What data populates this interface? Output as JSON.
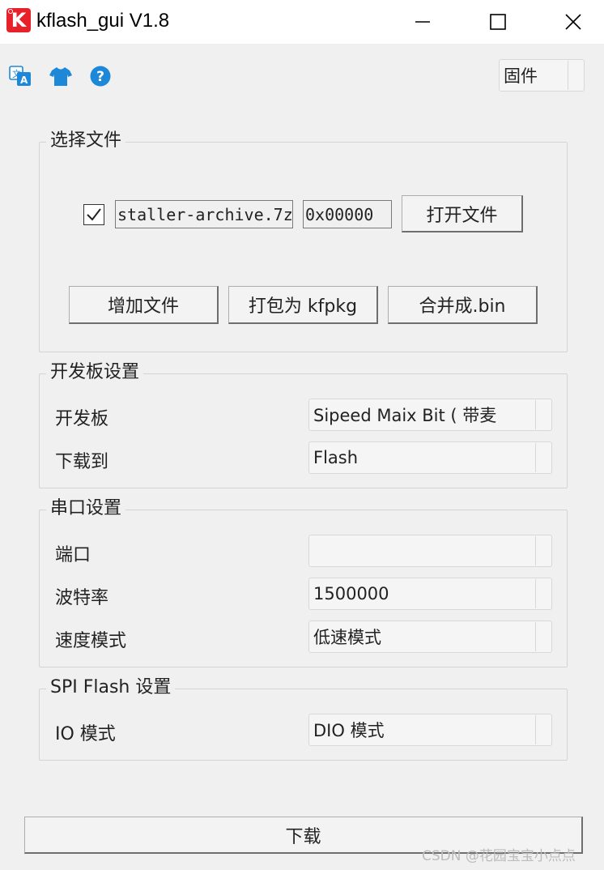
{
  "window": {
    "title": "kflash_gui V1.8",
    "logo_letter": "K"
  },
  "toolbar": {
    "icons": [
      "translate-icon",
      "shirt-icon",
      "help-icon"
    ],
    "mode_select": "固件"
  },
  "file_group": {
    "title": "选择文件",
    "file_checked": true,
    "file_name": "staller-archive.7z",
    "address": "0x00000",
    "open_label": "打开文件",
    "add_label": "增加文件",
    "pack_label": "打包为 kfpkg",
    "merge_label": "合并成.bin"
  },
  "board_group": {
    "title": "开发板设置",
    "board_label": "开发板",
    "board_value": "Sipeed Maix Bit ( 带麦",
    "target_label": "下载到",
    "target_value": "Flash"
  },
  "serial_group": {
    "title": "串口设置",
    "port_label": "端口",
    "port_value": "",
    "baud_label": "波特率",
    "baud_value": "1500000",
    "speed_label": "速度模式",
    "speed_value": "低速模式"
  },
  "spi_group": {
    "title": "SPI Flash 设置",
    "io_label": "IO 模式",
    "io_value": "DIO 模式"
  },
  "download_label": "下载",
  "watermark": "CSDN @花园宝宝小点点",
  "colors": {
    "logo": "#e8202a",
    "icon_blue": "#1e88d8",
    "background": "#f0f0f0"
  }
}
